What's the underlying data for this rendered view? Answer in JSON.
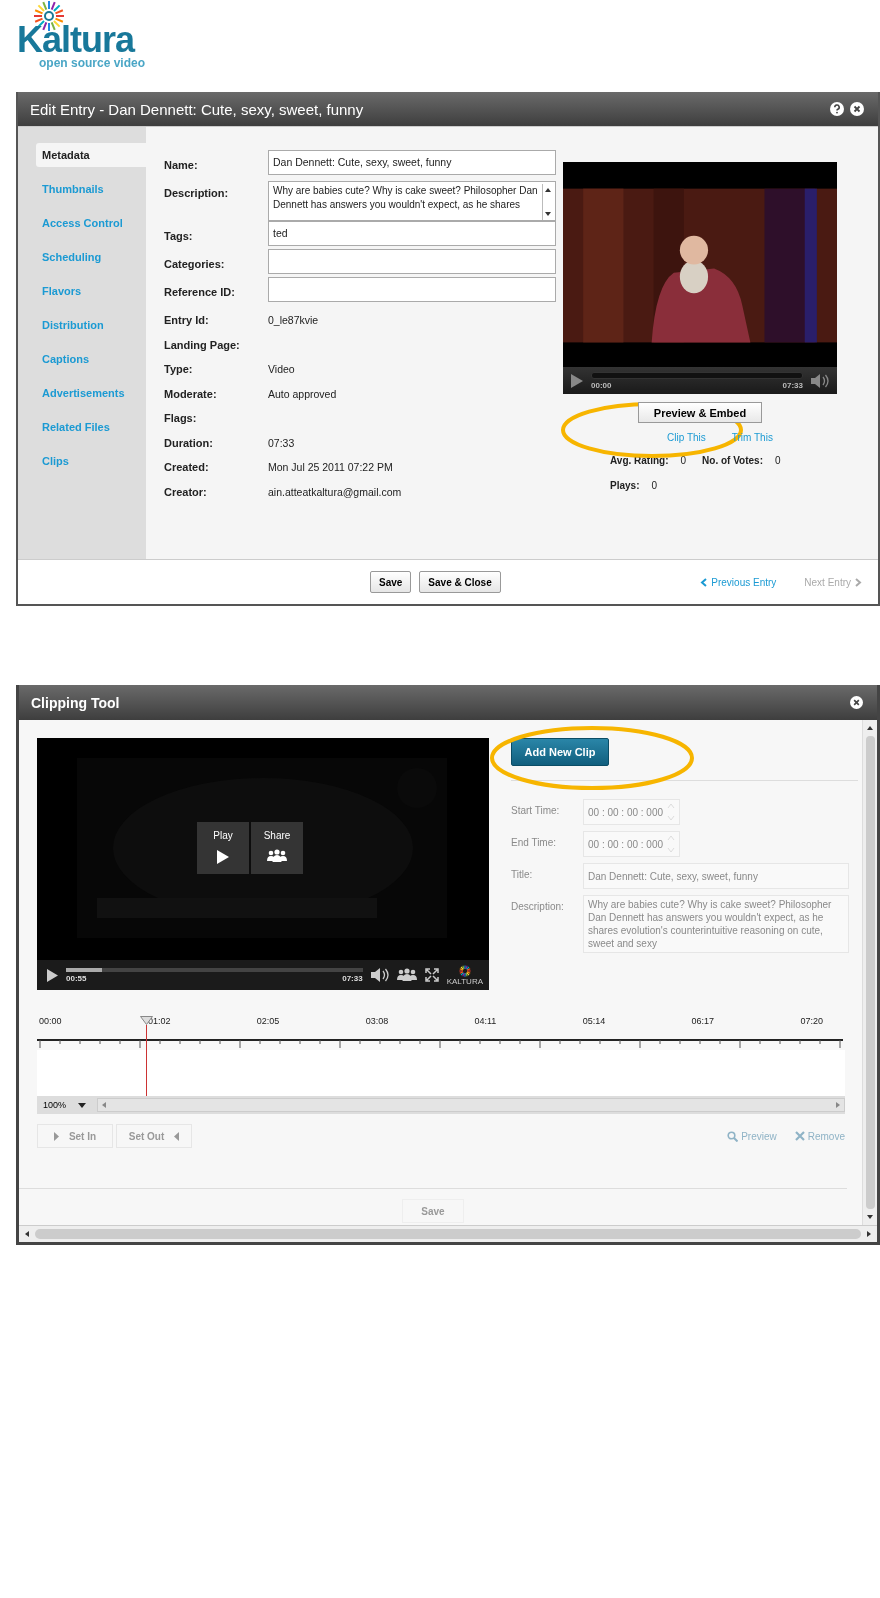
{
  "logo": {
    "name": "Kaltura",
    "tagline": "open source video"
  },
  "edit_entry": {
    "title": "Edit Entry - Dan Dennett: Cute, sexy, sweet, funny",
    "tabs": [
      {
        "label": "Metadata",
        "selected": true
      },
      {
        "label": "Thumbnails",
        "selected": false
      },
      {
        "label": "Access Control",
        "selected": false
      },
      {
        "label": "Scheduling",
        "selected": false
      },
      {
        "label": "Flavors",
        "selected": false
      },
      {
        "label": "Distribution",
        "selected": false
      },
      {
        "label": "Captions",
        "selected": false
      },
      {
        "label": "Advertisements",
        "selected": false
      },
      {
        "label": "Related Files",
        "selected": false
      },
      {
        "label": "Clips",
        "selected": false
      }
    ],
    "fields": [
      {
        "label": "Name:",
        "kind": "input",
        "value": "Dan Dennett: Cute, sexy, sweet, funny"
      },
      {
        "label": "Description:",
        "kind": "textarea",
        "value": "Why are babies cute? Why is cake sweet? Philosopher Dan Dennett has answers you wouldn't expect, as he shares"
      },
      {
        "label": "Tags:",
        "kind": "input",
        "value": "ted"
      },
      {
        "label": "Categories:",
        "kind": "input"
      },
      {
        "label": "Reference ID:",
        "kind": "input"
      },
      {
        "label": "Entry Id:",
        "kind": "text",
        "value": "0_le87kvie"
      },
      {
        "label": "Landing Page:",
        "kind": "text"
      },
      {
        "label": "Type:",
        "kind": "text",
        "value": "Video"
      },
      {
        "label": "Moderate:",
        "kind": "text",
        "value": "Auto approved"
      },
      {
        "label": "Flags:",
        "kind": "text"
      },
      {
        "label": "Duration:",
        "kind": "text",
        "value": "07:33"
      },
      {
        "label": "Created:",
        "kind": "text",
        "value": "Mon Jul 25 2011 07:22 PM"
      },
      {
        "label": "Creator:",
        "kind": "text",
        "value": "ain.atteatkaltura@gmail.com"
      }
    ],
    "player": {
      "elapsed": "00:00",
      "duration": "07:33"
    },
    "preview_button": "Preview & Embed",
    "links": [
      "Clip This",
      "Trim This"
    ],
    "stats": [
      {
        "label": "Avg. Rating:",
        "value": "0"
      },
      {
        "label": "No. of Votes:",
        "value": "0"
      },
      {
        "label": "Plays:",
        "value": "0"
      }
    ],
    "buttons": [
      "Save",
      "Save & Close"
    ],
    "nav": [
      {
        "label": "Previous Entry",
        "disabled": false
      },
      {
        "label": "Next Entry",
        "disabled": true
      }
    ]
  },
  "clipping_tool": {
    "title": "Clipping Tool",
    "player": {
      "overlay_buttons": [
        "Play",
        "Share"
      ],
      "elapsed": "00:55",
      "duration": "07:33",
      "level": 0.12,
      "brand": "KALTURA"
    },
    "add_button": {
      "label": "Add New Clip",
      "disabled": false
    },
    "fields": [
      {
        "label": "Start Time:",
        "kind": "time",
        "value": "00 : 00 : 00 : 000",
        "disabled": true
      },
      {
        "label": "End Time:",
        "kind": "time",
        "value": "00 : 00 : 00 : 000",
        "disabled": true
      },
      {
        "label": "Title:",
        "kind": "input",
        "value": "Dan Dennett: Cute, sexy, sweet, funny",
        "disabled": true
      },
      {
        "label": "Description:",
        "kind": "textarea",
        "value": "Why are babies cute? Why is cake sweet? Philosopher Dan Dennett has answers you wouldn't expect, as he shares evolution's counterintuitive reasoning on cute, sweet and sexy",
        "disabled": true
      }
    ],
    "timeline": {
      "labels": [
        "00:00",
        "01:02",
        "02:05",
        "03:08",
        "04:11",
        "05:14",
        "06:17",
        "07:20"
      ],
      "level": 0.135,
      "zoom": "100%"
    },
    "set_buttons": [
      {
        "label": "Set In",
        "disabled": true
      },
      {
        "label": "Set Out",
        "disabled": true
      }
    ],
    "actions": [
      {
        "label": "Preview",
        "disabled": true
      },
      {
        "label": "Remove",
        "disabled": true
      }
    ],
    "save_button": {
      "label": "Save",
      "disabled": true
    }
  }
}
